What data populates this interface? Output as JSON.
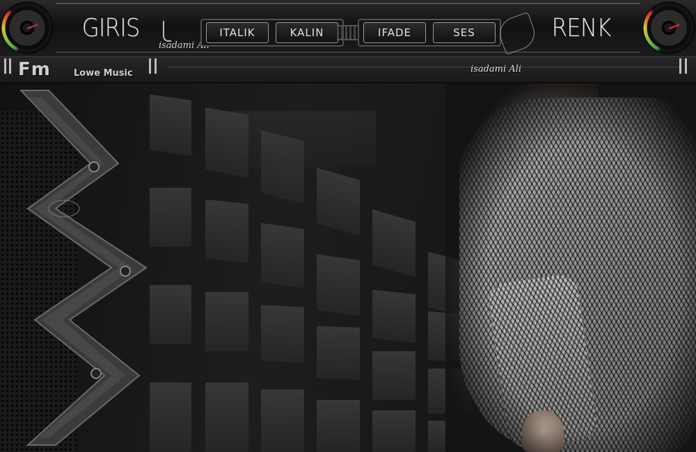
{
  "header": {
    "home_label": "GIRIS",
    "color_label": "RENK",
    "watermark": "isadami Ali",
    "format_buttons": [
      {
        "label": "ITALIK"
      },
      {
        "label": "KALIN"
      },
      {
        "label": "IFADE"
      },
      {
        "label": "SES"
      }
    ]
  },
  "subbar": {
    "logo": "Fm",
    "brand": "Lowe Music"
  },
  "stage": {
    "watermark": "isadami Ali"
  },
  "colors": {
    "background": "#141414",
    "tile": "#333333",
    "meter_green": "#3fa33f",
    "meter_red": "#c92c2c"
  },
  "icons": [
    "speaker-left-icon",
    "speaker-right-icon"
  ]
}
